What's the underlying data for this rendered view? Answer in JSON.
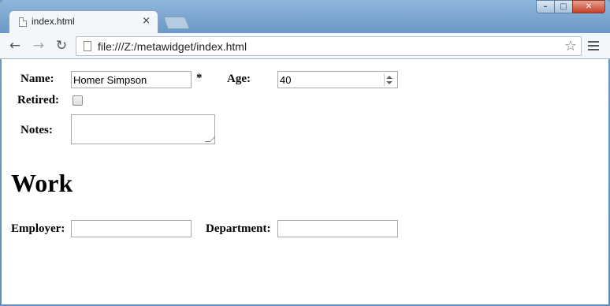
{
  "browser": {
    "tab_title": "index.html",
    "tab_close": "×",
    "url": "file:///Z:/metawidget/index.html",
    "window_controls": {
      "minimize": "–",
      "maximize": "□",
      "close": "✕"
    }
  },
  "form": {
    "name_label": "Name:",
    "name_value": "Homer Simpson",
    "required_marker": "*",
    "age_label": "Age:",
    "age_value": "40",
    "retired_label": "Retired:",
    "retired_checked": false,
    "notes_label": "Notes:",
    "notes_value": ""
  },
  "work": {
    "heading": "Work",
    "employer_label": "Employer:",
    "employer_value": "",
    "department_label": "Department:",
    "department_value": ""
  },
  "icons": {
    "back": "←",
    "forward": "→",
    "reload": "↻",
    "star": "☆"
  }
}
